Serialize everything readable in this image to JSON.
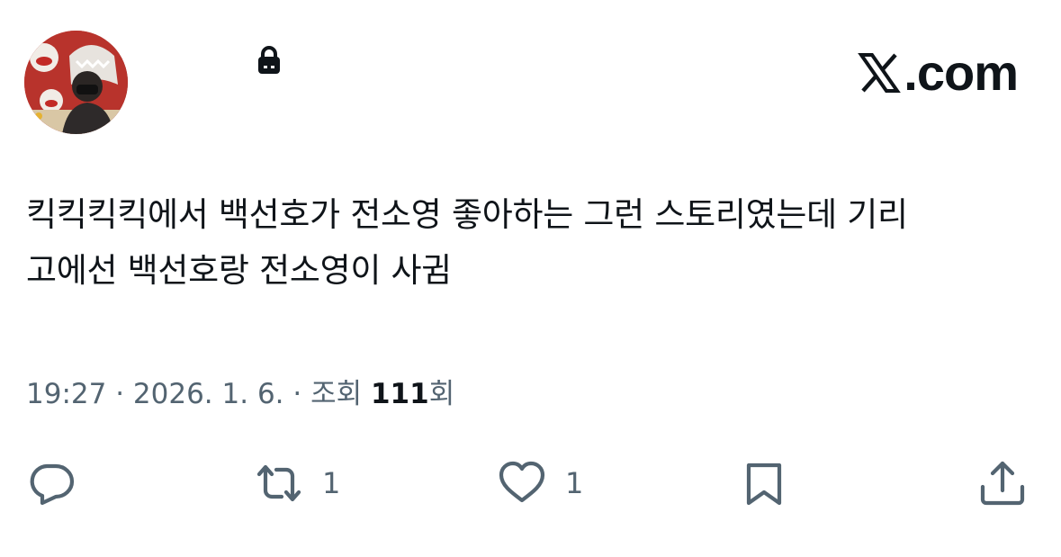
{
  "header": {
    "brand_domain": ".com",
    "lock": "lock-icon",
    "avatar": "avatar"
  },
  "tweet": {
    "line1": "킥킥킥킥에서 백선호가 전소영 좋아하는 그런 스토리였는데 기리",
    "line2": "고에선 백선호랑 전소영이 사귐"
  },
  "meta": {
    "time": "19:27",
    "sep1": " · ",
    "date": "2026. 1. 6.",
    "sep2": " · ",
    "views_prefix": "조회 ",
    "views_count": "111",
    "views_suffix": "회"
  },
  "actions": {
    "reply": {
      "icon": "reply-icon"
    },
    "repost": {
      "icon": "repost-icon",
      "count": "1"
    },
    "like": {
      "icon": "heart-icon",
      "count": "1"
    },
    "bookmark": {
      "icon": "bookmark-icon"
    },
    "share": {
      "icon": "share-icon"
    }
  },
  "colors": {
    "text": "#0f1419",
    "secondary": "#536471"
  }
}
